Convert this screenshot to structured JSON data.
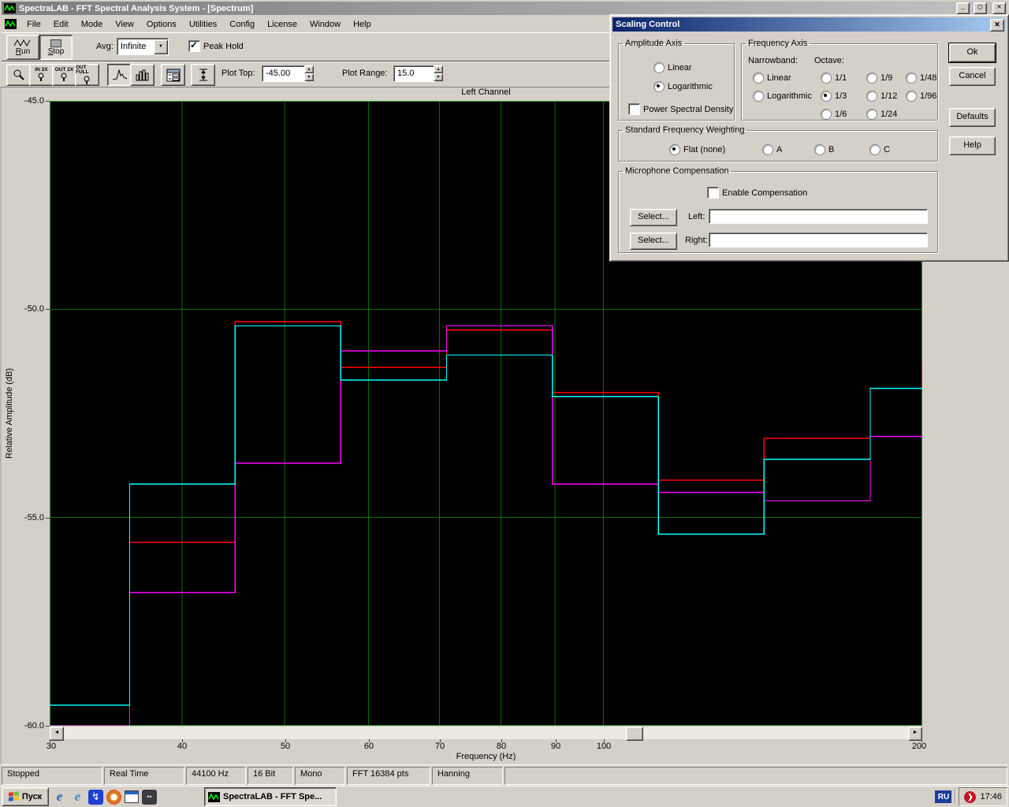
{
  "window": {
    "title": "SpectraLAB - FFT Spectral Analysis System - [Spectrum]",
    "menus": [
      "File",
      "Edit",
      "Mode",
      "View",
      "Options",
      "Utilities",
      "Config",
      "License",
      "Window",
      "Help"
    ],
    "toolbar1": {
      "run_label": "Run",
      "stop_label": "Stop",
      "avg_label": "Avg:",
      "avg_value": "Infinite",
      "peak_hold_label": "Peak Hold",
      "peak_hold_checked": true
    },
    "toolbar2": {
      "zoom_in_label": "IN 2X",
      "zoom_out_label": "OUT 2X",
      "zoom_full_label": "OUT FULL",
      "plot_top_label": "Plot Top:",
      "plot_top_value": "-45.00",
      "plot_range_label": "Plot Range:",
      "plot_range_value": "15.0"
    }
  },
  "chart_data": {
    "type": "line",
    "style": "one-third-octave-step-spectrum-peak-hold",
    "title": "Left Channel",
    "xlabel": "Frequency (Hz)",
    "ylabel": "Relative Amplitude (dB)",
    "x_scale": "log",
    "xlim": [
      30,
      200
    ],
    "ylim": [
      -60,
      -45
    ],
    "x_ticks": [
      30,
      40,
      50,
      60,
      70,
      80,
      90,
      100,
      200
    ],
    "y_ticks": [
      "-45.0",
      "-50.0",
      "-55.0",
      "-60.0"
    ],
    "y_gridlines": [
      -50,
      -55
    ],
    "grid_color": "#007400",
    "frame_color": "#2f8f2f",
    "plot_bg": "#000000",
    "band_edges_hz": [
      30,
      35.7,
      44.9,
      56.5,
      71.1,
      89.5,
      112.7,
      141.8,
      178.6,
      200
    ],
    "series": [
      {
        "name": "red-trace",
        "color": "#ff0000",
        "values": [
          -60.3,
          -55.6,
          -50.3,
          -51.4,
          -50.5,
          -52.0,
          -54.1,
          -53.1,
          -51.9
        ],
        "right_edge_to": -51.25
      },
      {
        "name": "magenta-trace",
        "color": "#ff00ff",
        "values": [
          -60.0,
          -56.8,
          -53.7,
          -51.0,
          -50.4,
          -54.2,
          -54.4,
          -54.6,
          -53.05
        ]
      },
      {
        "name": "cyan-trace",
        "color": "#00ffff",
        "values": [
          -59.5,
          -54.2,
          -50.4,
          -51.7,
          -51.1,
          -52.1,
          -55.4,
          -53.6,
          -51.9
        ]
      }
    ]
  },
  "dialog": {
    "title": "Scaling Control",
    "amplitude_axis": {
      "legend": "Amplitude Axis",
      "options": [
        "Linear",
        "Logarithmic"
      ],
      "selected": "Logarithmic",
      "psd_label": "Power Spectral Density",
      "psd_checked": false
    },
    "frequency_axis": {
      "legend": "Frequency Axis",
      "narrowband_label": "Narrowband:",
      "octave_label": "Octave:",
      "narrowband_options": [
        "Linear",
        "Logarithmic"
      ],
      "narrowband_selected": "none",
      "octave_options": [
        "1/1",
        "1/9",
        "1/48",
        "1/3",
        "1/12",
        "1/96",
        "1/6",
        "1/24"
      ],
      "octave_selected": "1/3"
    },
    "weighting": {
      "legend": "Standard Frequency Weighting",
      "options": [
        "Flat (none)",
        "A",
        "B",
        "C"
      ],
      "selected": "Flat (none)"
    },
    "mic": {
      "legend": "Microphone Compensation",
      "enable_label": "Enable Compensation",
      "enable_checked": false,
      "select_label": "Select...",
      "left_label": "Left:",
      "right_label": "Right:",
      "left_value": "",
      "right_value": ""
    },
    "buttons": [
      "Ok",
      "Cancel",
      "Defaults",
      "Help"
    ]
  },
  "status_bar": [
    "Stopped",
    "Real Time",
    "44100 Hz",
    "16 Bit",
    "Mono",
    "FFT 16384 pts",
    "Hanning"
  ],
  "taskbar": {
    "start_label": "Пуск",
    "task_label": "SpectraLAB - FFT Spe...",
    "lang_indicator": "RU",
    "clock": "17:46"
  },
  "glyphs": {
    "minimize": "_",
    "maximize": "▢",
    "close": "✕",
    "dropdown": "▼",
    "spin_up": "▲",
    "spin_down": "▼",
    "scroll_left": "◄",
    "scroll_right": "►",
    "tray_chevron": "❯"
  }
}
